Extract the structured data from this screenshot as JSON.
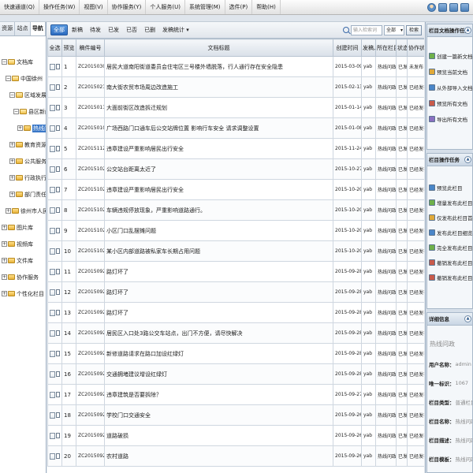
{
  "menu": [
    {
      "label": "快速通道(Q)"
    },
    {
      "label": "操作任务(W)"
    },
    {
      "label": "视图(V)"
    },
    {
      "label": "协作服务(Y)"
    },
    {
      "label": "个人服务(U)"
    },
    {
      "label": "系统管理(M)"
    },
    {
      "label": "选件(P)"
    },
    {
      "label": "帮助(H)"
    }
  ],
  "left_tabs": [
    {
      "label": "资源",
      "active": false
    },
    {
      "label": "站点",
      "active": false
    },
    {
      "label": "导航",
      "active": true
    }
  ],
  "tree": [
    {
      "label": "文档库",
      "level": 0,
      "expanded": true,
      "selected": false
    },
    {
      "label": "中国徐州",
      "level": 1,
      "expanded": true,
      "selected": false
    },
    {
      "label": "区域发展",
      "level": 2,
      "expanded": true,
      "selected": false
    },
    {
      "label": "县区新闻",
      "level": 3,
      "expanded": true,
      "selected": false
    },
    {
      "label": "热线问政",
      "level": 4,
      "expanded": false,
      "selected": true
    },
    {
      "label": "教育资源",
      "level": 2,
      "expanded": false,
      "selected": false
    },
    {
      "label": "公共服务",
      "level": 2,
      "expanded": false,
      "selected": false
    },
    {
      "label": "行政执行公示清单",
      "level": 2,
      "expanded": false,
      "selected": false
    },
    {
      "label": "部门责任清单",
      "level": 2,
      "expanded": false,
      "selected": false
    },
    {
      "label": "徐州市人民政府信息公开",
      "level": 1,
      "expanded": false,
      "selected": false
    },
    {
      "label": "图片库",
      "level": 0,
      "expanded": false,
      "selected": false
    },
    {
      "label": "视频库",
      "level": 0,
      "expanded": false,
      "selected": false
    },
    {
      "label": "文件库",
      "level": 0,
      "expanded": false,
      "selected": false
    },
    {
      "label": "协作服务",
      "level": 0,
      "expanded": false,
      "selected": false
    },
    {
      "label": "个性化栏目",
      "level": 0,
      "expanded": false,
      "selected": false
    }
  ],
  "toolbar": {
    "tabs": [
      {
        "label": "全部",
        "active": true
      },
      {
        "label": "新稿",
        "active": false
      },
      {
        "label": "待发",
        "active": false
      },
      {
        "label": "已发",
        "active": false
      },
      {
        "label": "已否",
        "active": false
      },
      {
        "label": "已删",
        "active": false
      }
    ],
    "extra": "发稿统计 ▾",
    "search_placeholder": "输入检索词",
    "scope": "全部",
    "search_button": "检索"
  },
  "table": {
    "headers": [
      "全选",
      "预览",
      "稿件编号",
      "文档标题",
      "创建时间",
      "发稿人",
      "所在栏目",
      "状态",
      "协作状态"
    ],
    "rows": [
      {
        "num": "1",
        "id": "ZC20150309850",
        "title": "居民大道南阳街道委员会住宅区三号楼外墙脱落，行人通行存在安全隐患",
        "date": "2015-03-09 11",
        "author": "yab",
        "column": "热线问政",
        "status": "已发",
        "state": "未发布"
      },
      {
        "num": "2",
        "id": "ZC20150213874",
        "title": "南大街农贸市场周边改造施工",
        "date": "2015-02-13 21",
        "author": "yab",
        "column": "热线问政",
        "status": "已发",
        "state": "已经发布"
      },
      {
        "num": "3",
        "id": "ZC20150114782",
        "title": "大面前街区改造拆迁规划",
        "date": "2015-01-14 13",
        "author": "yab",
        "column": "热线问政",
        "status": "已发",
        "state": "已经发布"
      },
      {
        "num": "4",
        "id": "ZC20150108635",
        "title": "广场西路门口通车后公交站牌位置 影响行车安全 请求调整设置",
        "date": "2015-01-08 14",
        "author": "yab",
        "column": "热线问政",
        "status": "已发",
        "state": "已经发布"
      },
      {
        "num": "5",
        "id": "ZC20151124790",
        "title": "违章建设严重影响居民出行安全",
        "date": "2015-11-24 12",
        "author": "yab",
        "column": "热线问政",
        "status": "已发",
        "state": "已经发布"
      },
      {
        "num": "6",
        "id": "ZC20151027355",
        "title": "公交站台距离太近了",
        "date": "2015-10-27 22",
        "author": "yab",
        "column": "热线问政",
        "status": "已发",
        "state": "已经发布"
      },
      {
        "num": "7",
        "id": "ZC20151020024",
        "title": "违章建设严重影响居民出行安全",
        "date": "2015-10-20 06",
        "author": "yab",
        "column": "热线问政",
        "status": "已发",
        "state": "已经发布"
      },
      {
        "num": "8",
        "id": "ZC20151020564",
        "title": "车辆违规停放现象，严重影响道路通行。",
        "date": "2015-10-20 09",
        "author": "yab",
        "column": "热线问政",
        "status": "已发",
        "state": "已经发布"
      },
      {
        "num": "9",
        "id": "ZC20151020861",
        "title": "小区门口乱摆摊问题",
        "date": "2015-10-20 09",
        "author": "yab",
        "column": "热线问政",
        "status": "已发",
        "state": "已经发布"
      },
      {
        "num": "10",
        "id": "ZC20151020143",
        "title": "某小区内部道路被私家车长期占用问题",
        "date": "2015-10-20 19",
        "author": "yab",
        "column": "热线问政",
        "status": "已发",
        "state": "已经发布"
      },
      {
        "num": "11",
        "id": "ZC20150928040",
        "title": "路灯坏了",
        "date": "2015-09-28 09",
        "author": "yab",
        "column": "热线问政",
        "status": "已发",
        "state": "已经发布"
      },
      {
        "num": "12",
        "id": "ZC20150928046",
        "title": "路灯坏了",
        "date": "2015-09-28 10",
        "author": "yab",
        "column": "热线问政",
        "status": "已发",
        "state": "已经发布"
      },
      {
        "num": "13",
        "id": "ZC20150928048",
        "title": "路灯坏了",
        "date": "2015-09-28 10",
        "author": "yab",
        "column": "热线问政",
        "status": "已发",
        "state": "已经发布"
      },
      {
        "num": "14",
        "id": "ZC20150928080",
        "title": "居民区入口处3路公交车站点，出门不方便，请尽快解决",
        "date": "2015-09-28 10",
        "author": "yab",
        "column": "热线问政",
        "status": "已发",
        "state": "已经发布"
      },
      {
        "num": "15",
        "id": "ZC20150928046",
        "title": "新修道路请求在路口加设红绿灯",
        "date": "2015-09-28 10",
        "author": "yab",
        "column": "热线问政",
        "status": "已发",
        "state": "已经发布"
      },
      {
        "num": "16",
        "id": "ZC20150928094",
        "title": "交通拥堵建议增设红绿灯",
        "date": "2015-09-28 19",
        "author": "yab",
        "column": "热线问政",
        "status": "已发",
        "state": "已经发布"
      },
      {
        "num": "17",
        "id": "ZC20150927004",
        "title": "违章建筑是否要拆除？",
        "date": "2015-09-27 15",
        "author": "yab",
        "column": "热线问政",
        "status": "已发",
        "state": "已经发布"
      },
      {
        "num": "18",
        "id": "ZC20150926532",
        "title": "学校门口交通安全",
        "date": "2015-09-26 09",
        "author": "yab",
        "column": "热线问政",
        "status": "已发",
        "state": "已经发布"
      },
      {
        "num": "19",
        "id": "ZC20150926017",
        "title": "道路破损",
        "date": "2015-09-26 06",
        "author": "yab",
        "column": "热线问政",
        "status": "已发",
        "state": "已经发布"
      },
      {
        "num": "20",
        "id": "ZC20150926003",
        "title": "农村道路",
        "date": "2015-09-26 06",
        "author": "yab",
        "column": "热线问政",
        "status": "已发",
        "state": "已经发布"
      }
    ]
  },
  "right": {
    "doc_tasks_title": "栏目文档操作任务",
    "doc_tasks": [
      {
        "label": "创建一篇新文档",
        "color": "#6fb04a"
      },
      {
        "label": "预览当前文档",
        "color": "#e0a93a"
      },
      {
        "label": "从外部导入文档",
        "color": "#4a86c8"
      },
      {
        "label": "预览所有文档",
        "color": "#c85a4a"
      },
      {
        "label": "导出所有文档",
        "color": "#8a6fc0"
      }
    ],
    "channel_tasks_title": "栏目操作任务",
    "channel_tasks": [
      {
        "label": "预览此栏目",
        "color": "#4a86c8"
      },
      {
        "label": "增量发布此栏目",
        "color": "#6fb04a"
      },
      {
        "label": "仅发布此栏目首页",
        "color": "#e0a93a"
      },
      {
        "label": "发布此栏目细览",
        "color": "#4a86c8"
      },
      {
        "label": "完全发布此栏目",
        "color": "#6fb04a"
      },
      {
        "label": "撤销发布此栏目",
        "color": "#c85a4a"
      },
      {
        "label": "撤销发布此栏目首页",
        "color": "#c85a4a"
      }
    ],
    "details_title": "详细信息",
    "details_name": "热线问政",
    "details": [
      {
        "label": "用户名称：",
        "value": "admin"
      },
      {
        "label": "唯一标识：",
        "value": "1067"
      },
      {
        "label": "栏目类型：",
        "value": "普通栏目"
      },
      {
        "label": "栏目名称：",
        "value": "热线问政"
      },
      {
        "label": "栏目描述：",
        "value": "热线问政"
      },
      {
        "label": "栏目模板：",
        "value": "热线问政"
      }
    ]
  }
}
